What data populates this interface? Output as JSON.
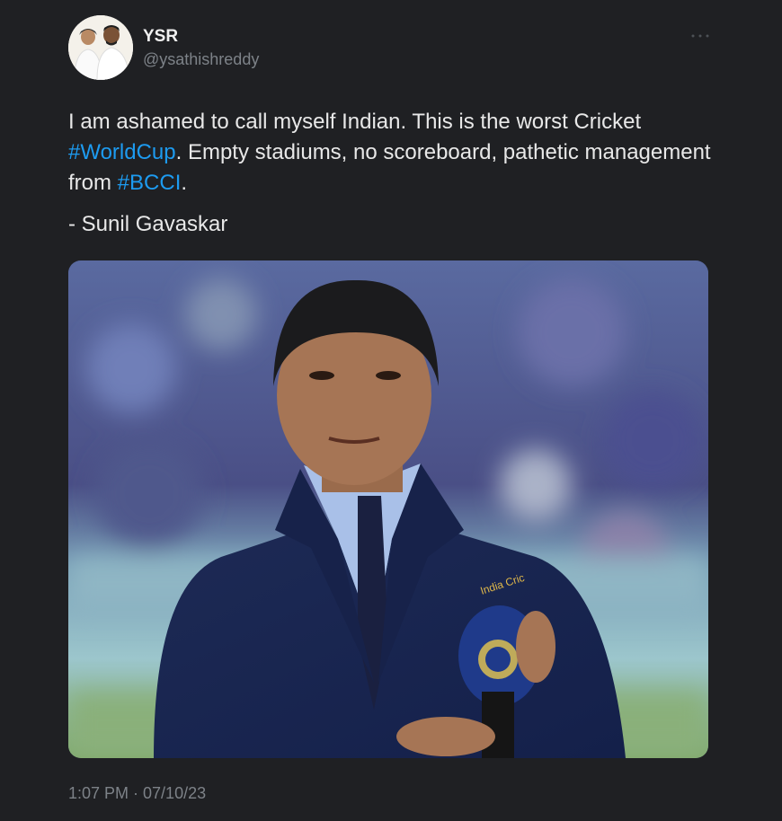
{
  "author": {
    "display_name": "YSR",
    "handle": "@ysathishreddy"
  },
  "more_icon": "more-horizontal-icon",
  "tweet": {
    "line1_before": "I am ashamed to call myself Indian. This is the worst Cricket ",
    "hashtag_worldcup": "#WorldCup",
    "line1_after": ". Empty stadiums, no scoreboard, pathetic management from ",
    "hashtag_bcci": "#BCCI",
    "line1_end": ".",
    "attribution": "- Sunil Gavaskar"
  },
  "media": {
    "jacket_text": "India Cric"
  },
  "timestamp": "1:07 PM · 07/10/23",
  "colors": {
    "background": "#1f2023",
    "hashtag": "#1d9bf0",
    "text": "#e8e8e8",
    "muted": "#7d8288"
  }
}
